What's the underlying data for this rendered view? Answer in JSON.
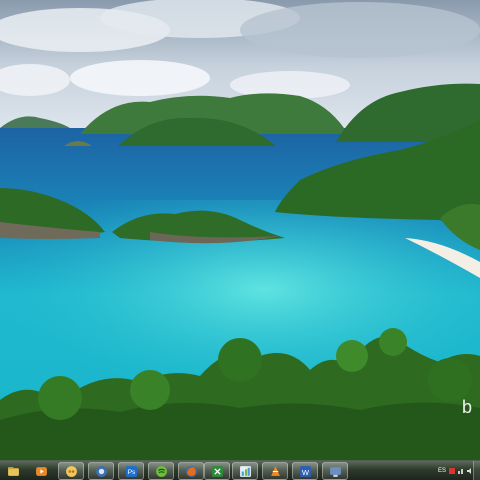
{
  "desktop": {
    "wallpaper": "tropical-bay-wallpaper",
    "watermark_text": "b"
  },
  "taskbar": {
    "items": [
      {
        "icon": "folder-icon",
        "color": "#e8c25a"
      },
      {
        "icon": "media-player-icon",
        "color": "#e98a2a"
      },
      {
        "icon": "chat-icon",
        "color": "#f0c85a"
      },
      {
        "icon": "browser-globe-icon",
        "color": "#3a6fb0"
      },
      {
        "icon": "photoshop-icon",
        "color": "#1d6fd0",
        "label": "Ps"
      },
      {
        "icon": "music-app-icon",
        "color": "#6bbf3a"
      },
      {
        "icon": "firefox-icon",
        "color": "#e76a1f"
      },
      {
        "icon": "excel-icon",
        "color": "#2f8a3a"
      },
      {
        "icon": "chart-app-icon",
        "color": "#4f9ad8"
      },
      {
        "icon": "vlc-icon",
        "color": "#f08a1c"
      },
      {
        "icon": "word-icon",
        "color": "#2c5fb5",
        "label": "W"
      },
      {
        "icon": "monitor-icon",
        "color": "#6a8fc0"
      }
    ],
    "tray": {
      "language": "ES",
      "icons": [
        "flag-icon",
        "network-icon",
        "volume-icon"
      ]
    }
  }
}
